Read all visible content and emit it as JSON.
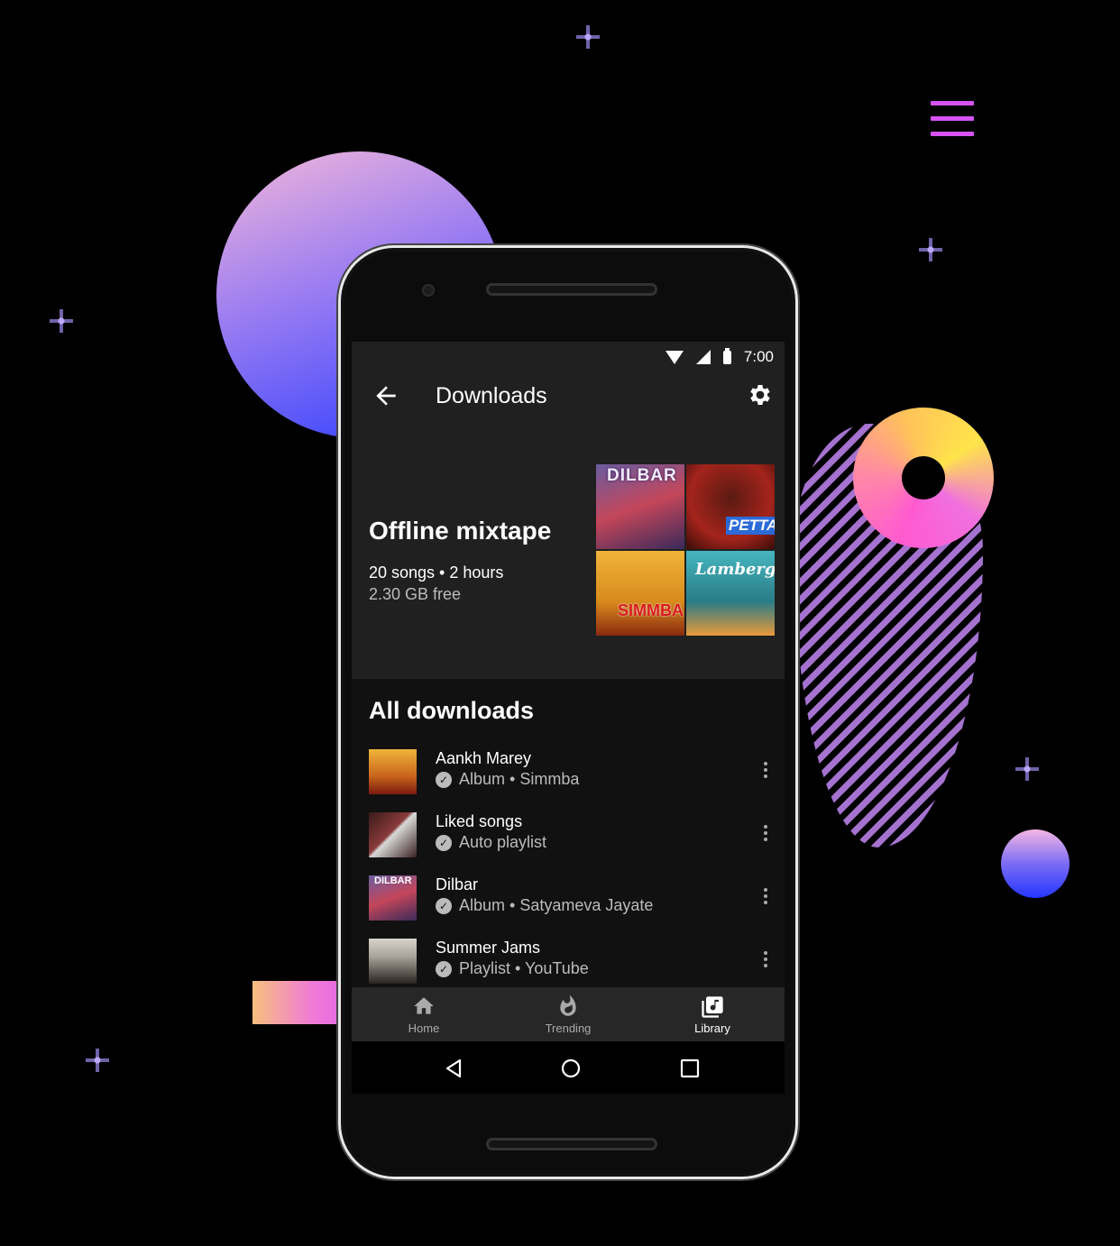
{
  "status_bar": {
    "time": "7:00"
  },
  "app_bar": {
    "title": "Downloads"
  },
  "mixtape": {
    "title": "Offline mixtape",
    "meta": "20 songs • 2 hours",
    "free_space": "2.30 GB free",
    "covers": [
      "DILBAR",
      "PETTA",
      "SIMMBA",
      "Lamberghini"
    ]
  },
  "all_downloads": {
    "title": "All downloads",
    "items": [
      {
        "title": "Aankh Marey",
        "subtitle": "Album • Simmba"
      },
      {
        "title": "Liked songs",
        "subtitle": "Auto playlist"
      },
      {
        "title": "Dilbar",
        "subtitle": "Album • Satyameva Jayate",
        "thumb_text": "DILBAR"
      },
      {
        "title": "Summer Jams",
        "subtitle": "Playlist • YouTube"
      }
    ]
  },
  "bottom_nav": {
    "home": "Home",
    "trending": "Trending",
    "library": "Library"
  },
  "colors": {
    "accent_purple": "#d752f5",
    "screen_bg": "#111111",
    "surface": "#202020"
  }
}
